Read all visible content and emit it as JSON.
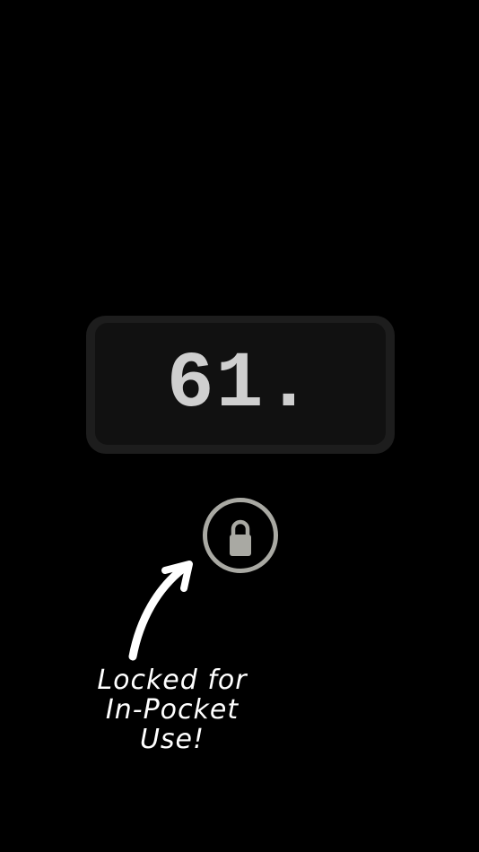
{
  "display": {
    "value": "61."
  },
  "lock": {
    "icon": "lock-icon",
    "color": "#a9a9a3"
  },
  "annotation": {
    "lines": [
      "Locked for",
      "In-Pocket",
      "Use!"
    ],
    "arrow_icon": "curved-arrow-icon"
  },
  "colors": {
    "background": "#000000",
    "panel": "#1d1d1d",
    "panel_inner": "#111111",
    "digits": "#cfcfcf",
    "note": "#ffffff"
  }
}
